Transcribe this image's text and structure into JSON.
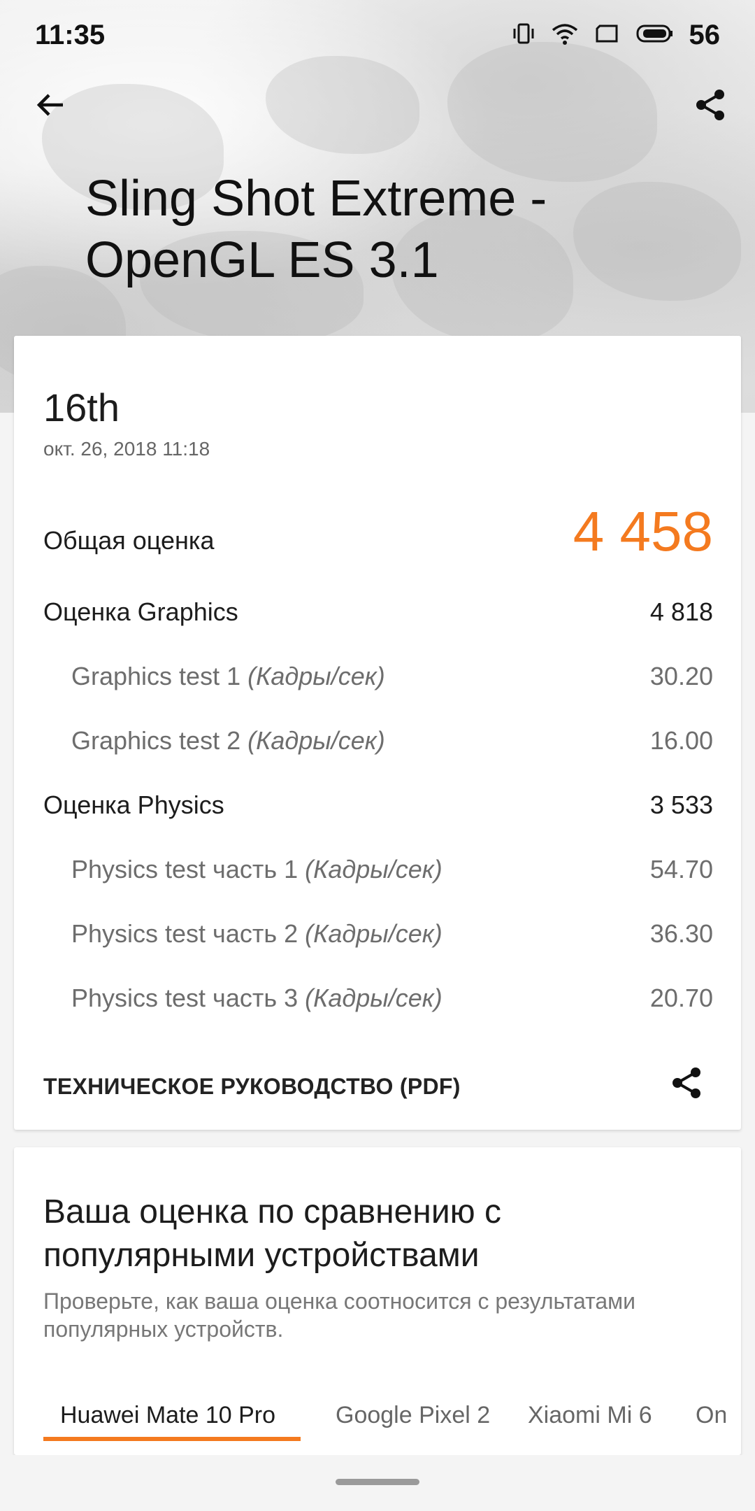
{
  "status_bar": {
    "time": "11:35",
    "battery_percent": "56"
  },
  "page": {
    "title": "Sling Shot Extreme - OpenGL ES 3.1"
  },
  "result": {
    "rank": "16th",
    "date": "окт. 26, 2018 11:18",
    "overall": {
      "label": "Общая оценка",
      "value": "4 458"
    },
    "graphics": {
      "label": "Оценка Graphics",
      "value": "4 818"
    },
    "graphics_tests": [
      {
        "label": "Graphics test 1 ",
        "unit": "(Кадры/сек)",
        "value": "30.20"
      },
      {
        "label": "Graphics test 2 ",
        "unit": "(Кадры/сек)",
        "value": "16.00"
      }
    ],
    "physics": {
      "label": "Оценка Physics",
      "value": "3 533"
    },
    "physics_tests": [
      {
        "label": "Physics test часть 1 ",
        "unit": "(Кадры/сек)",
        "value": "54.70"
      },
      {
        "label": "Physics test часть 2 ",
        "unit": "(Кадры/сек)",
        "value": "36.30"
      },
      {
        "label": "Physics test часть 3 ",
        "unit": "(Кадры/сек)",
        "value": "20.70"
      }
    ],
    "tech_guide_label": "ТЕХНИЧЕСКОЕ РУКОВОДСТВО (PDF)"
  },
  "comparison": {
    "title": "Ваша оценка по сравнению с популярными устройствами",
    "subtitle": "Проверьте, как ваша оценка соотносится с результатами популярных устройств.",
    "tabs": [
      "Huawei Mate 10 Pro",
      "Google Pixel 2",
      "Xiaomi Mi 6",
      "On"
    ]
  },
  "colors": {
    "accent": "#f47a1f"
  },
  "icons": [
    "back-arrow-icon",
    "share-icon",
    "vibrate-icon",
    "wifi-icon",
    "screen-icon",
    "battery-icon"
  ]
}
